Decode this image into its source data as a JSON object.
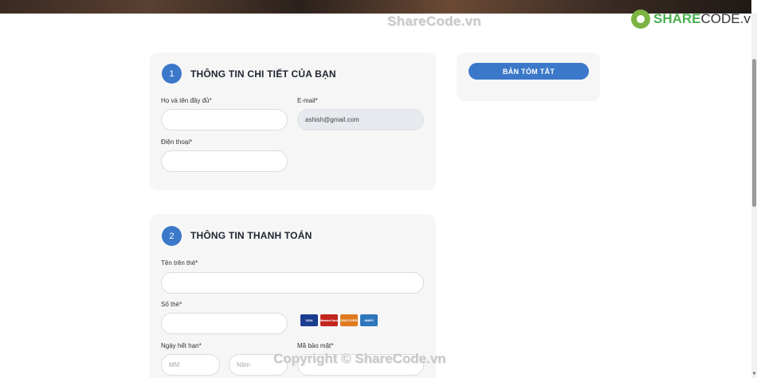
{
  "watermark": {
    "top": "ShareCode.vn",
    "bottom": "Copyright © ShareCode.vn"
  },
  "logo": {
    "brand": "SHARE",
    "suffix": "CODE.vn"
  },
  "section1": {
    "step": "1",
    "title": "THÔNG TIN CHI TIẾT CỦA BẠN",
    "fullname_label": "Họ và tên đầy đủ*",
    "fullname_value": "",
    "email_label": "E-mail*",
    "email_value": "ashish@gmail.com",
    "phone_label": "Điện thoại*",
    "phone_value": ""
  },
  "section2": {
    "step": "2",
    "title": "THÔNG TIN THANH TOÁN",
    "cardname_label": "Tên trên thẻ*",
    "cardnumber_label": "Số thẻ*",
    "expiry_label": "Ngày hết hạn*",
    "month_placeholder": "MM",
    "year_placeholder": "Năm",
    "cvv_label": "Mã bảo mật*",
    "card_logos": [
      {
        "name": "VISA",
        "color": "#1a3d8f"
      },
      {
        "name": "MasterCard",
        "color": "#c2261f"
      },
      {
        "name": "DISCOVER",
        "color": "#e07a1f"
      },
      {
        "name": "AMEX",
        "color": "#2e77bb"
      }
    ]
  },
  "summary": {
    "button_label": "BẢN TÓM TẮT"
  },
  "colors": {
    "accent": "#3b78c9",
    "card_bg": "#f6f6f6"
  }
}
